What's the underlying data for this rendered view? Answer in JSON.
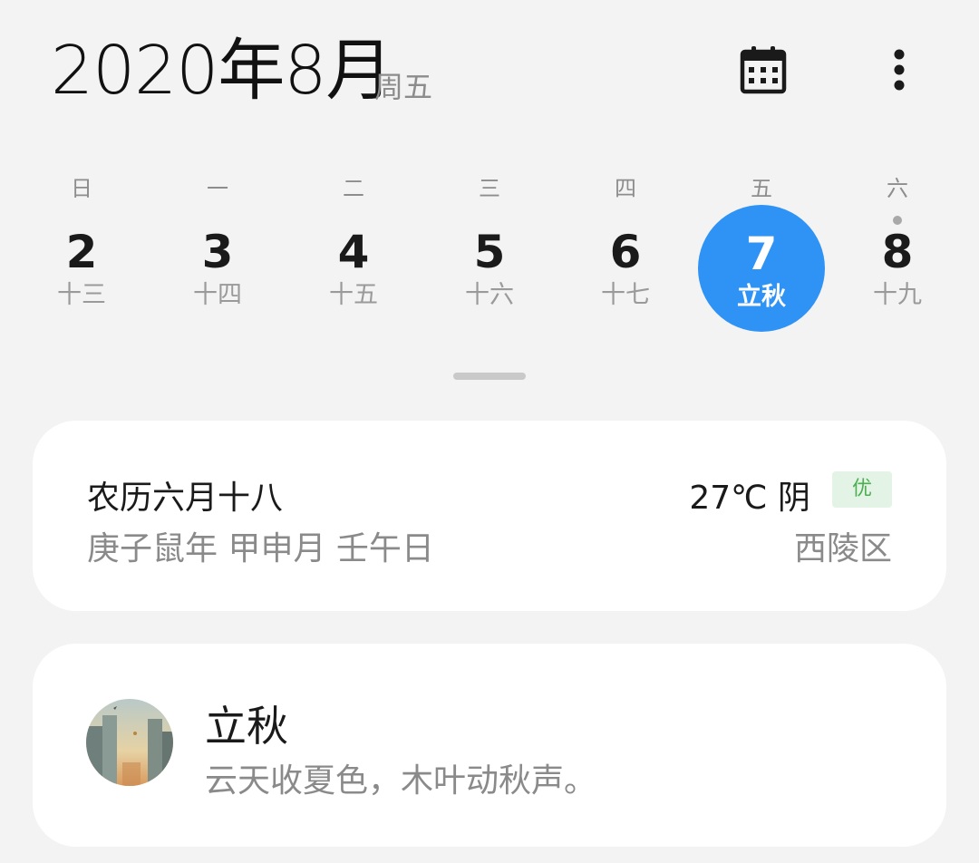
{
  "header": {
    "title": "2020年8月",
    "weekday": "周五",
    "calendar_icon": "calendar-icon",
    "more_icon": "more-vertical-icon"
  },
  "week": {
    "days": [
      {
        "dow": "日",
        "num": "2",
        "lunar": "十三",
        "selected": false,
        "dot": false
      },
      {
        "dow": "一",
        "num": "3",
        "lunar": "十四",
        "selected": false,
        "dot": false
      },
      {
        "dow": "二",
        "num": "4",
        "lunar": "十五",
        "selected": false,
        "dot": false
      },
      {
        "dow": "三",
        "num": "5",
        "lunar": "十六",
        "selected": false,
        "dot": false
      },
      {
        "dow": "四",
        "num": "6",
        "lunar": "十七",
        "selected": false,
        "dot": false
      },
      {
        "dow": "五",
        "num": "7",
        "lunar": "立秋",
        "selected": true,
        "dot": false
      },
      {
        "dow": "六",
        "num": "8",
        "lunar": "十九",
        "selected": false,
        "dot": true
      }
    ],
    "selected_color": "#2f93f5"
  },
  "info_card": {
    "lunar_date": "农历六月十八",
    "ganzhi": "庚子鼠年 甲申月 壬午日",
    "weather": "27℃ 阴",
    "aqi": "优",
    "district": "西陵区"
  },
  "solar_term_card": {
    "title": "立秋",
    "poem": "云天收夏色，木叶动秋声。"
  }
}
